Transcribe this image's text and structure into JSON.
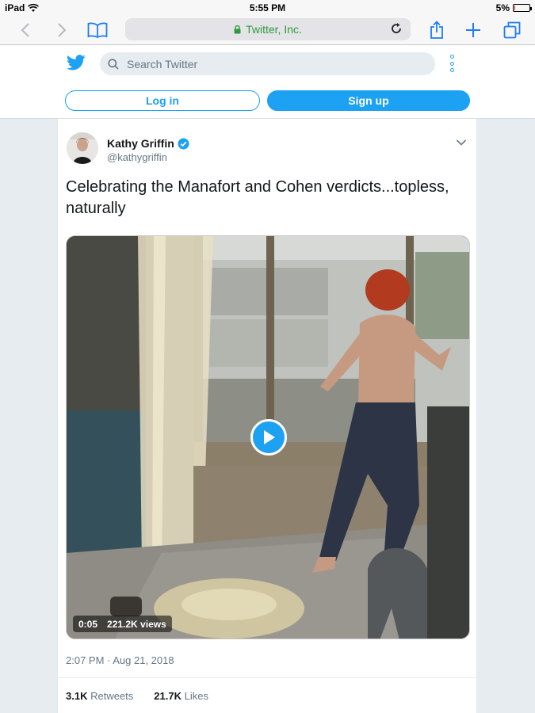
{
  "status_bar": {
    "device": "iPad",
    "time": "5:55 PM",
    "battery": "5%",
    "battery_level": 0.05
  },
  "browser": {
    "address": "Twitter, Inc.",
    "icons": [
      "back-icon",
      "forward-icon",
      "bookmarks-icon",
      "lock-icon",
      "reload-icon",
      "share-icon",
      "new-tab-icon",
      "tabs-icon"
    ]
  },
  "twitter_header": {
    "search_placeholder": "Search Twitter",
    "login_label": "Log in",
    "signup_label": "Sign up"
  },
  "tweet": {
    "author_name": "Kathy Griffin",
    "author_handle": "@kathygriffin",
    "text": "Celebrating the Manafort and Cohen verdicts...topless, naturally",
    "video_time": "0:05",
    "video_views": "221.2K views",
    "timestamp": "2:07 PM · Aug 21, 2018",
    "retweets_count": "3.1K",
    "retweets_label": "Retweets",
    "likes_count": "21.7K",
    "likes_label": "Likes"
  },
  "colors": {
    "twitter_blue": "#1da1f2",
    "ios_blue": "#1e7cf6",
    "secure_green": "#2e9b3a",
    "secondary_text": "#657786"
  }
}
